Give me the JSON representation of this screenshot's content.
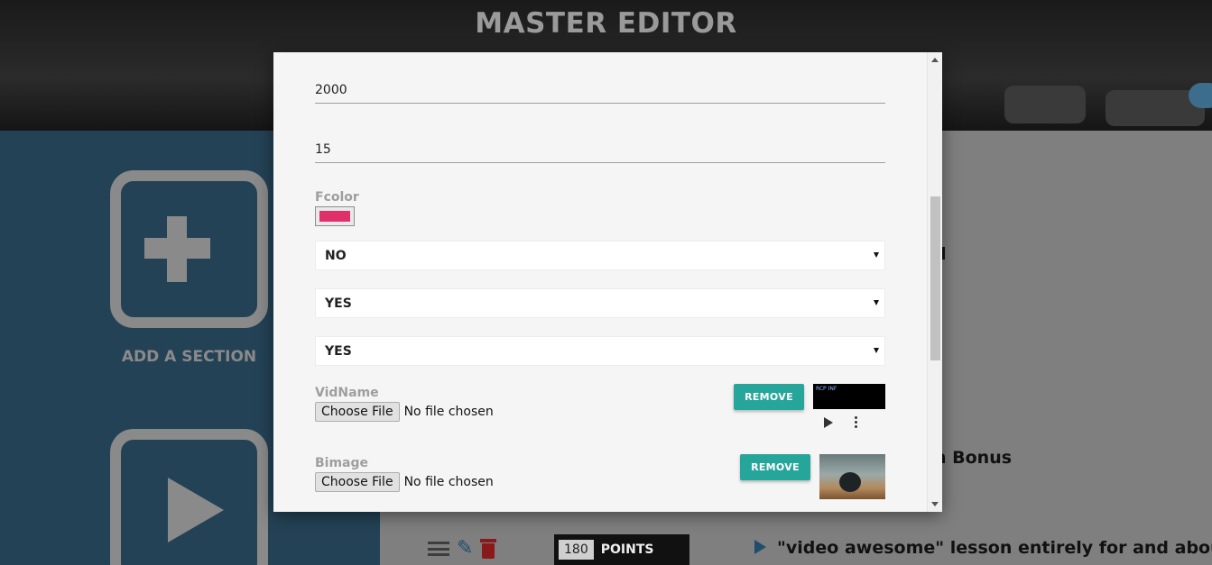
{
  "page": {
    "title": "MASTER EDITOR",
    "sidebar": {
      "add_section_label": "ADD A SECTION"
    },
    "background_text": {
      "partial_1": "d",
      "partial_2": "n Bonus",
      "lesson_title": "\"video awesome\" lesson entirely for and about t",
      "points_value": "180",
      "points_label": "POINTS"
    }
  },
  "modal": {
    "fields": {
      "value_1": "2000",
      "value_2": "15",
      "fcolor_label": "Fcolor",
      "fcolor_value": "#e0306a",
      "select_1": "NO",
      "select_2": "YES",
      "select_3": "YES",
      "vidname_label": "VidName",
      "bimage_label": "Bimage",
      "choose_file_label": "Choose File",
      "no_file_text": "No file chosen",
      "remove_label": "REMOVE",
      "video_logo_text": "RCP INF"
    }
  },
  "colors": {
    "accent_teal": "#26a69a",
    "sidebar_blue": "#244256",
    "delete_red": "#8a1a1a"
  }
}
